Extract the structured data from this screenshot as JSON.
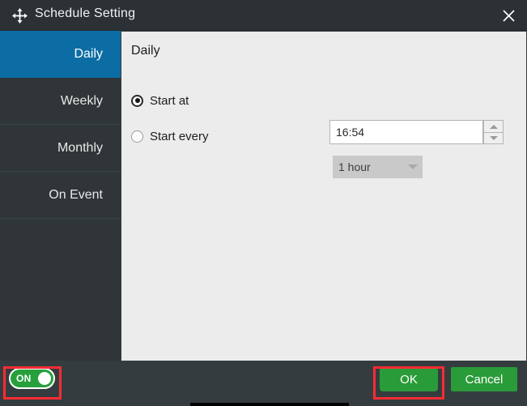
{
  "window": {
    "title": "Schedule Setting",
    "move_icon": "move-arrows-icon",
    "close_icon": "close-icon"
  },
  "sidebar": {
    "items": [
      {
        "label": "Daily",
        "selected": true
      },
      {
        "label": "Weekly",
        "selected": false
      },
      {
        "label": "Monthly",
        "selected": false
      },
      {
        "label": "On Event",
        "selected": false
      }
    ]
  },
  "content": {
    "heading": "Daily",
    "options": {
      "start_at": {
        "label": "Start at",
        "selected": true,
        "time_value": "16:54",
        "spin_up_icon": "triangle-up-icon",
        "spin_down_icon": "triangle-down-icon"
      },
      "start_every": {
        "label": "Start every",
        "selected": false,
        "interval_value": "1 hour",
        "chevron_icon": "chevron-down-icon"
      }
    }
  },
  "footer": {
    "toggle": {
      "label": "ON",
      "state": "on"
    },
    "ok_label": "OK",
    "cancel_label": "Cancel"
  },
  "colors": {
    "titlebar": "#2b3134",
    "sidebar": "#2f3538",
    "accent_selected": "#0c6da4",
    "panel": "#ececec",
    "footer": "#353c3f",
    "green_button": "#2a9b39",
    "toggle_green": "#27a03c",
    "annotation_red": "#fb2c33"
  }
}
